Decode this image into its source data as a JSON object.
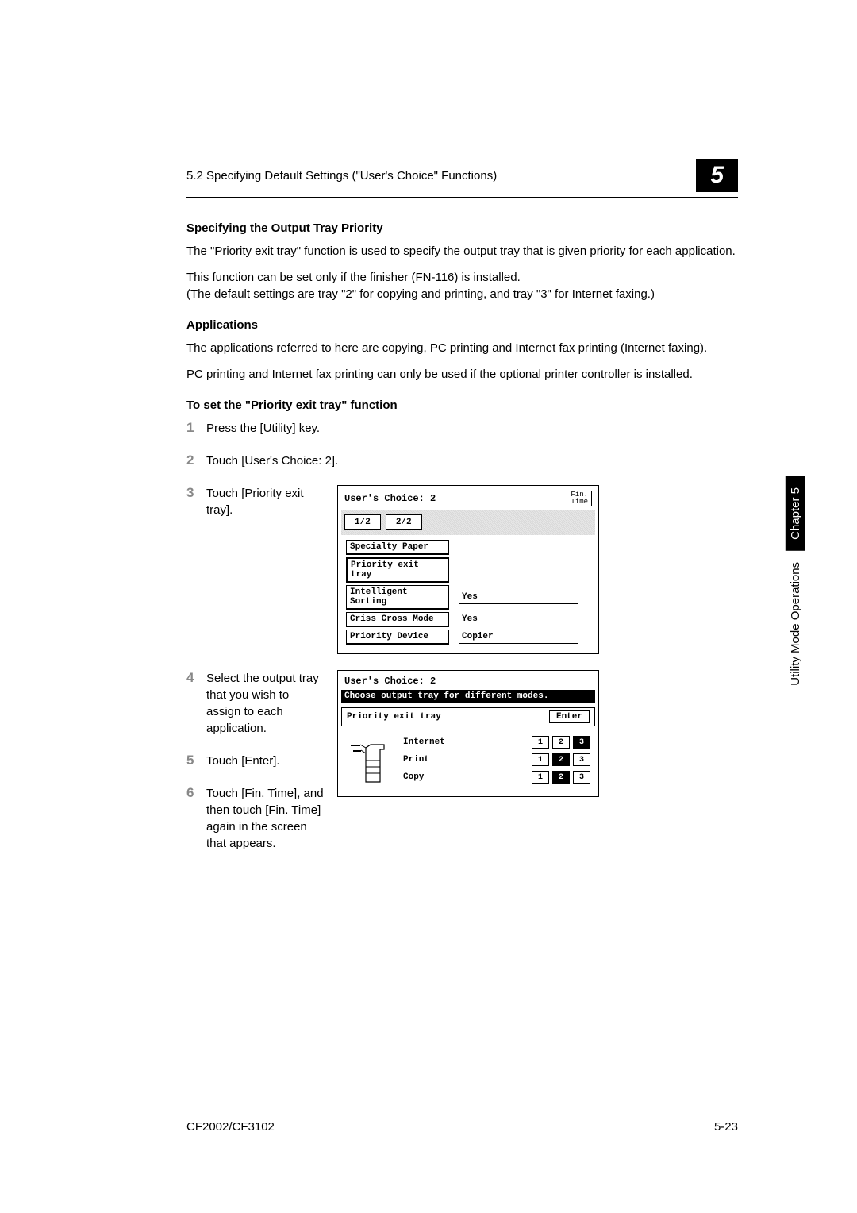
{
  "header": {
    "section": "5.2 Specifying Default Settings (\"User's Choice\" Functions)",
    "chapter_num": "5"
  },
  "headings": {
    "h1": "Specifying the Output Tray Priority",
    "h2": "Applications",
    "h3": "To set the \"Priority exit tray\" function"
  },
  "paragraphs": {
    "p1": "The \"Priority exit tray\" function is used to specify the output tray that is given priority for each application.",
    "p2": "This function can be set only if the finisher (FN-116) is installed.\n(The default settings are tray \"2\" for copying and printing, and tray \"3\" for Internet faxing.)",
    "p3": "The applications referred to here are copying, PC printing and Internet fax printing (Internet faxing).",
    "p4": "PC printing and Internet fax printing can only be used if the optional printer controller is installed."
  },
  "steps": {
    "s1": "Press the [Utility] key.",
    "s2": "Touch [User's Choice: 2].",
    "s3": "Touch [Priority exit tray].",
    "s4": "Select the output tray that you wish to assign to each application.",
    "s5": "Touch [Enter].",
    "s6": "Touch [Fin. Time], and then touch [Fin. Time] again in the screen that appears."
  },
  "step_nums": {
    "n1": "1",
    "n2": "2",
    "n3": "3",
    "n4": "4",
    "n5": "5",
    "n6": "6"
  },
  "screen1": {
    "title": "User's Choice: 2",
    "fin_top": "Fin.",
    "fin_bot": "Time",
    "tab1": "1/2",
    "tab2": "2/2",
    "options": [
      {
        "label": "Specialty Paper",
        "value": ""
      },
      {
        "label": "Priority exit tray",
        "value": ""
      },
      {
        "label": "Intelligent Sorting",
        "value": "Yes"
      },
      {
        "label": "Criss Cross Mode",
        "value": "Yes"
      },
      {
        "label": "Priority Device",
        "value": "Copier"
      }
    ]
  },
  "screen2": {
    "title": "User's Choice: 2",
    "instruction": "Choose output tray for different modes.",
    "section": "Priority exit tray",
    "enter": "Enter",
    "rows": [
      {
        "label": "Internet",
        "selected": 3
      },
      {
        "label": "Print",
        "selected": 2
      },
      {
        "label": "Copy",
        "selected": 2
      }
    ],
    "nums": [
      "1",
      "2",
      "3"
    ]
  },
  "footer": {
    "model": "CF2002/CF3102",
    "page": "5-23"
  },
  "side": {
    "operations": "Utility Mode Operations",
    "chapter": "Chapter 5"
  }
}
